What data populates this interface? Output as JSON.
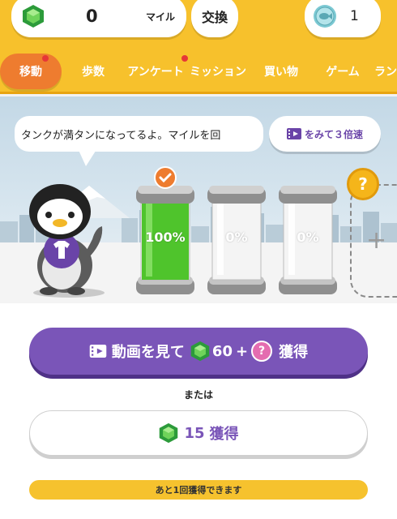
{
  "header": {
    "miles_value": "0",
    "miles_unit": "マイル",
    "exchange_label": "交換",
    "coin_value": "1"
  },
  "tabs": [
    {
      "label": "移動",
      "active": true,
      "dot": true
    },
    {
      "label": "歩数",
      "active": false,
      "dot": false
    },
    {
      "label": "アンケート",
      "active": false,
      "dot": true
    },
    {
      "label": "ミッション",
      "active": false,
      "dot": false
    },
    {
      "label": "買い物",
      "active": false,
      "dot": false
    },
    {
      "label": "ゲーム",
      "active": false,
      "dot": false
    },
    {
      "label": "ラン",
      "active": false,
      "dot": false
    }
  ],
  "hero": {
    "speech": "タンクが満タンになってるよ。マイルを回",
    "triple_button": "をみて３倍速",
    "tanks": [
      {
        "label": "100%",
        "fill": 1.0
      },
      {
        "label": "0%",
        "fill": 0.0
      },
      {
        "label": "0%",
        "fill": 0.0
      }
    ],
    "question_mark": "?",
    "plus": "+"
  },
  "actions": {
    "video_prefix": "動画を見て",
    "video_amount": "60",
    "video_plus": "+",
    "video_suffix": "獲得",
    "question_mark": "?",
    "or_text": "または",
    "gem_amount": "15",
    "gem_suffix": "獲得",
    "remaining": "あと1回獲得できます"
  },
  "colors": {
    "header_bg": "#f7c12c",
    "active_tab": "#ee7c2f",
    "purple": "#7a55b8",
    "green_tank": "#4fc42c"
  }
}
